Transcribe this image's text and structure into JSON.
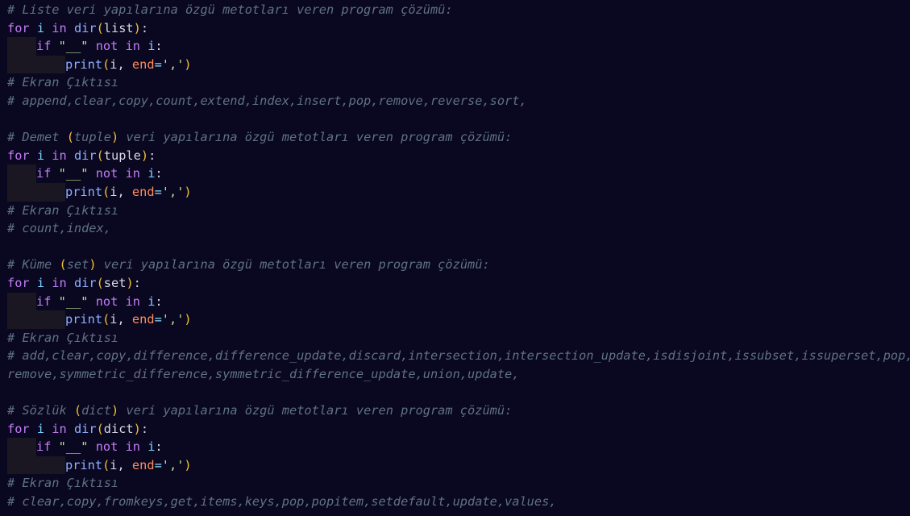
{
  "sections": [
    {
      "header": {
        "prefix": "# Liste veri yapılarına özgü metotları veren program çözümü:",
        "paren_open": "",
        "name": "",
        "paren_close": "",
        "suffix": ""
      },
      "type_name": "list",
      "output_label": "# Ekran Çıktısı",
      "output_lines": [
        "# append,clear,copy,count,extend,index,insert,pop,remove,reverse,sort,"
      ]
    },
    {
      "header": {
        "prefix": "# Demet ",
        "paren_open": "(",
        "name": "tuple",
        "paren_close": ")",
        "suffix": " veri yapılarına özgü metotları veren program çözümü:"
      },
      "type_name": "tuple",
      "output_label": "# Ekran Çıktısı",
      "output_lines": [
        "# count,index,"
      ]
    },
    {
      "header": {
        "prefix": "# Küme ",
        "paren_open": "(",
        "name": "set",
        "paren_close": ")",
        "suffix": " veri yapılarına özgü metotları veren program çözümü:"
      },
      "type_name": "set",
      "output_label": "# Ekran Çıktısı",
      "output_lines": [
        "# add,clear,copy,difference,difference_update,discard,intersection,intersection_update,isdisjoint,issubset,issuperset,pop,",
        "remove,symmetric_difference,symmetric_difference_update,union,update,"
      ]
    },
    {
      "header": {
        "prefix": "# Sözlük ",
        "paren_open": "(",
        "name": "dict",
        "paren_close": ")",
        "suffix": " veri yapılarına özgü metotları veren program çözümü:"
      },
      "type_name": "dict",
      "output_label": "# Ekran Çıktısı",
      "output_lines": [
        "# clear,copy,fromkeys,get,items,keys,pop,popitem,setdefault,update,values,"
      ]
    }
  ],
  "code": {
    "kw_for": "for",
    "loop_var": "i",
    "kw_in": "in",
    "fn_dir": "dir",
    "kw_if": "if",
    "dunder_str": "\"__\"",
    "kw_not": "not",
    "fn_print": "print",
    "param_end": "end",
    "end_value": "','"
  },
  "colors": {
    "background": "#0a0720",
    "indent_guide": "#1b1722",
    "comment": "#5f7286",
    "keyword": "#c27df5",
    "function": "#8fb1ff",
    "variable": "#7ecfff",
    "string": "#b4e38a",
    "parameter": "#ff8c5a",
    "bracket": "#f1c232"
  }
}
